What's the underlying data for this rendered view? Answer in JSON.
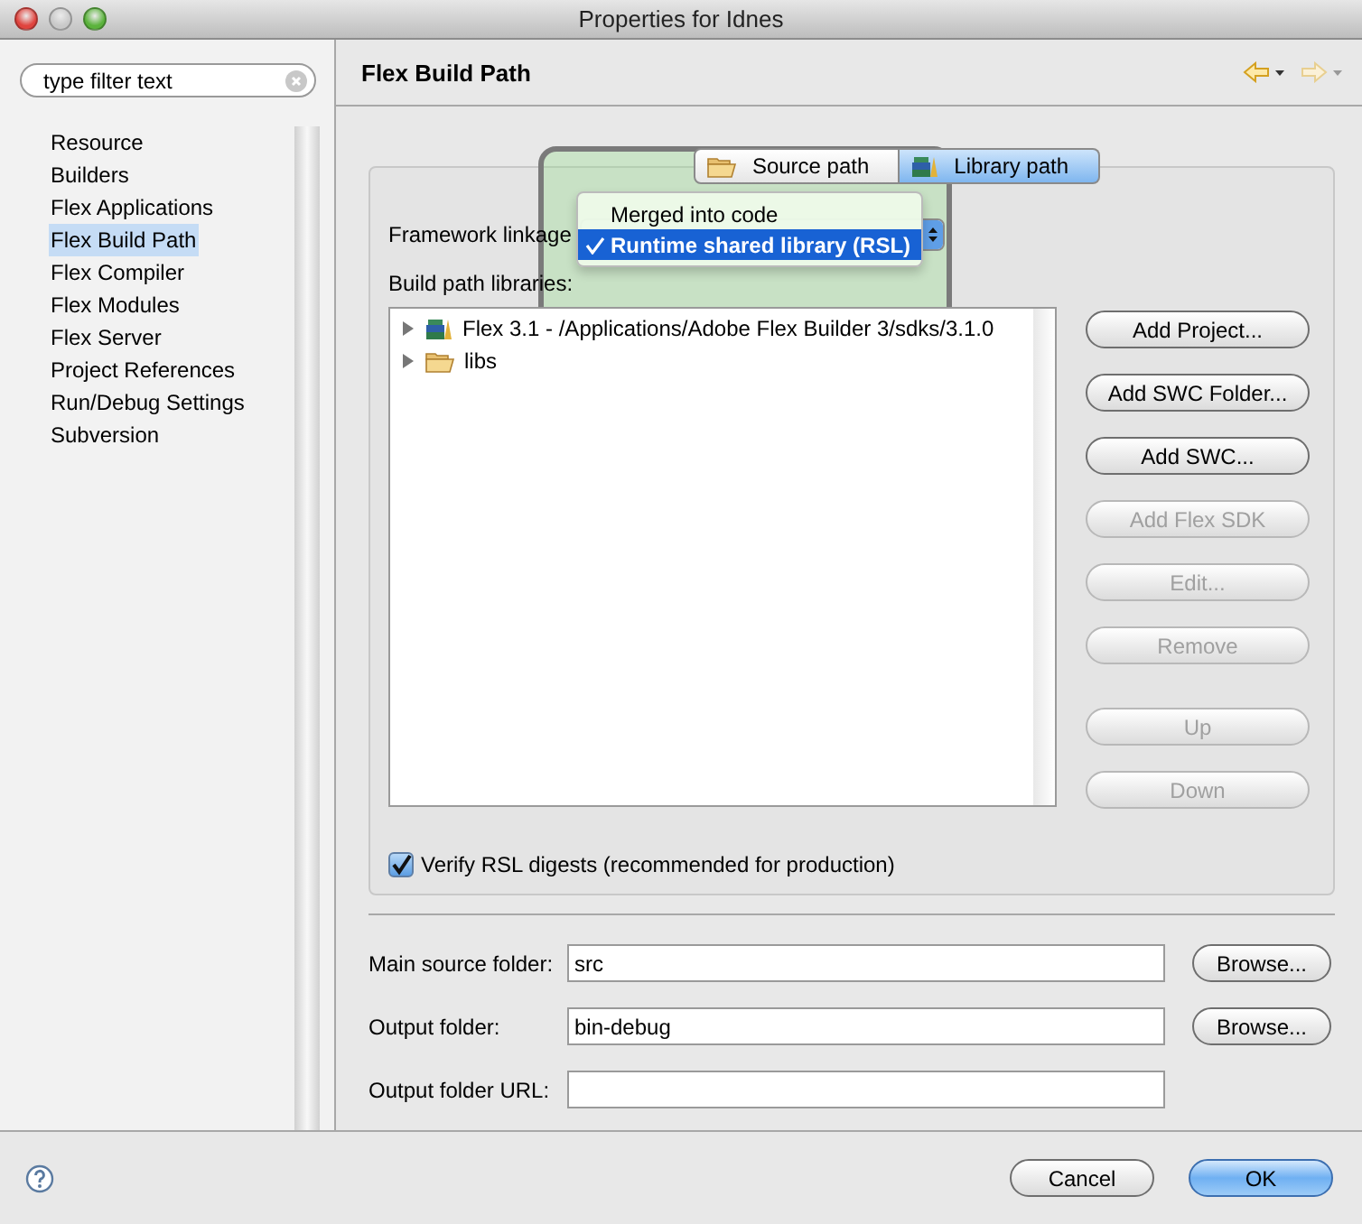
{
  "window": {
    "title": "Properties for Idnes"
  },
  "filter": {
    "placeholder": "type filter text"
  },
  "sidebar": {
    "items": [
      {
        "label": "Resource",
        "selected": false
      },
      {
        "label": "Builders",
        "selected": false
      },
      {
        "label": "Flex Applications",
        "selected": false
      },
      {
        "label": "Flex Build Path",
        "selected": true
      },
      {
        "label": "Flex Compiler",
        "selected": false
      },
      {
        "label": "Flex Modules",
        "selected": false
      },
      {
        "label": "Flex Server",
        "selected": false
      },
      {
        "label": "Project References",
        "selected": false
      },
      {
        "label": "Run/Debug Settings",
        "selected": false
      },
      {
        "label": "Subversion",
        "selected": false
      }
    ]
  },
  "page": {
    "title": "Flex Build Path"
  },
  "tabs": [
    {
      "label": "Source path",
      "selected": false,
      "kind": "folder"
    },
    {
      "label": "Library path",
      "selected": true,
      "kind": "library"
    }
  ],
  "framework_linkage": {
    "label": "Framework linkage",
    "options": [
      {
        "label": "Merged into code",
        "selected": false
      },
      {
        "label": "Runtime shared library (RSL)",
        "selected": true
      }
    ]
  },
  "libraries": {
    "label": "Build path libraries:",
    "items": [
      {
        "label": "Flex 3.1 - /Applications/Adobe Flex Builder 3/sdks/3.1.0",
        "kind": "library",
        "expanded": false
      },
      {
        "label": "libs",
        "kind": "folder",
        "expanded": false
      }
    ]
  },
  "library_buttons": [
    {
      "label": "Add Project...",
      "disabled": false
    },
    {
      "label": "Add SWC Folder...",
      "disabled": false
    },
    {
      "label": "Add SWC...",
      "disabled": false
    },
    {
      "label": "Add Flex SDK",
      "disabled": true
    },
    {
      "label": "Edit...",
      "disabled": true
    },
    {
      "label": "Remove",
      "disabled": true
    },
    {
      "label": "Up",
      "disabled": true
    },
    {
      "label": "Down",
      "disabled": true
    }
  ],
  "verify_rsl": {
    "label": "Verify RSL digests (recommended for production)",
    "checked": true
  },
  "fields": [
    {
      "label": "Main source folder:",
      "value": "src",
      "button": "Browse..."
    },
    {
      "label": "Output folder:",
      "value": "bin-debug",
      "button": "Browse..."
    },
    {
      "label": "Output folder URL:"
    }
  ],
  "footer_buttons": [
    {
      "label": "Cancel",
      "default": false
    },
    {
      "label": "OK",
      "default": true
    }
  ]
}
